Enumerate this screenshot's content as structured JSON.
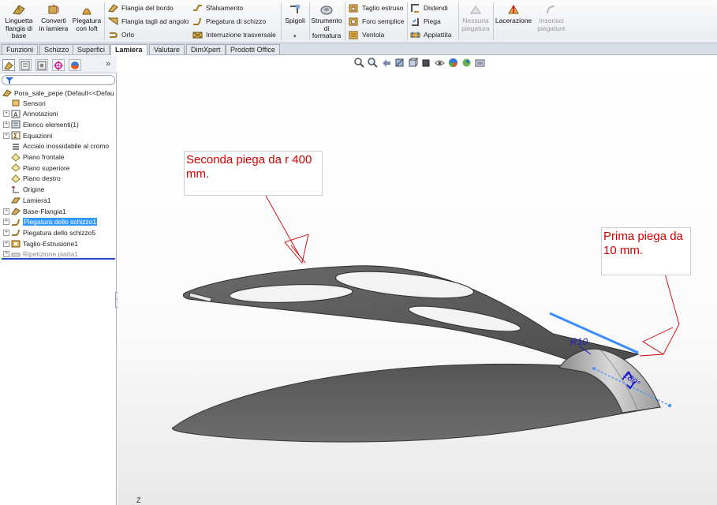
{
  "ribbon": {
    "large_buttons": [
      {
        "label1": "Linguetta",
        "label2": "flangia di",
        "label3": "base",
        "icon": "base-flange-icon"
      },
      {
        "label1": "Converti",
        "label2": "in lamiera",
        "icon": "convert-sheet-icon"
      },
      {
        "label1": "Piegatura",
        "label2": "con loft",
        "icon": "lofted-bend-icon"
      }
    ],
    "col1": [
      "Flangia del bordo",
      "Flangia tagli ad angolo",
      "Orlo"
    ],
    "col2": [
      "Sfalsamento",
      "Piegatura di schizzo",
      "Interruzione trasversale"
    ],
    "spigoli": "Spigoli",
    "strumento": {
      "label1": "Strumento",
      "label2": "di",
      "label3": "formatura"
    },
    "col3": [
      "Taglio estruso",
      "Foro semplice",
      "Ventola"
    ],
    "col4": [
      "Distendi",
      "Piega",
      "Appiattita"
    ],
    "nessuna": {
      "label1": "Nessuna",
      "label2": "piegatura"
    },
    "lacerazione": "Lacerazione",
    "inserisci": {
      "label1": "Inserisci",
      "label2": "piegature"
    }
  },
  "tabs": [
    "Funzioni",
    "Schizzo",
    "Superfici",
    "Lamiera",
    "Valutare",
    "DimXpert",
    "Prodotti Office"
  ],
  "active_tab": "Lamiera",
  "tree": {
    "root": "Pora_sale_pepe  (Default<<Defau",
    "items": [
      {
        "label": "Sensori",
        "expand": false,
        "icon": "sensor-icon"
      },
      {
        "label": "Annotazioni",
        "expand": true,
        "icon": "annotation-icon"
      },
      {
        "label": "Elenco elementi(1)",
        "expand": true,
        "icon": "cut-list-icon"
      },
      {
        "label": "Equazioni",
        "expand": true,
        "icon": "equation-icon"
      },
      {
        "label": "Acciaio inossidabile al cromo",
        "expand": false,
        "icon": "material-icon"
      },
      {
        "label": "Piano frontale",
        "expand": false,
        "icon": "plane-icon"
      },
      {
        "label": "Piano superiore",
        "expand": false,
        "icon": "plane-icon"
      },
      {
        "label": "Piano destro",
        "expand": false,
        "icon": "plane-icon"
      },
      {
        "label": "Origine",
        "expand": false,
        "icon": "origin-icon"
      },
      {
        "label": "Lamiera1",
        "expand": false,
        "icon": "sheet-metal-icon"
      },
      {
        "label": "Base-Flangia1",
        "expand": true,
        "icon": "base-flange-icon"
      },
      {
        "label": "Piegatura dello schizzo1",
        "expand": true,
        "icon": "sketched-bend-icon",
        "selected": true
      },
      {
        "label": "Piegatura dello schizzo5",
        "expand": true,
        "icon": "sketched-bend-icon"
      },
      {
        "label": "Taglio-Estrusione1",
        "expand": true,
        "icon": "extruded-cut-icon"
      },
      {
        "label": "Ripetizione piatta1",
        "expand": true,
        "icon": "flat-pattern-icon",
        "dim": true
      }
    ]
  },
  "viewport": {
    "callout1": {
      "line1": "Seconda piega da r 400",
      "line2": "mm."
    },
    "callout2": {
      "line1": "Prima piega da",
      "line2": "10 mm."
    },
    "dimension_r": "R10",
    "dimension_angle": "180°",
    "axis_label": "Z"
  },
  "colors": {
    "callout_text": "#d40000",
    "selection": "#3399ff",
    "part": "#5a5a5a",
    "sketch": "#1e6fff"
  }
}
